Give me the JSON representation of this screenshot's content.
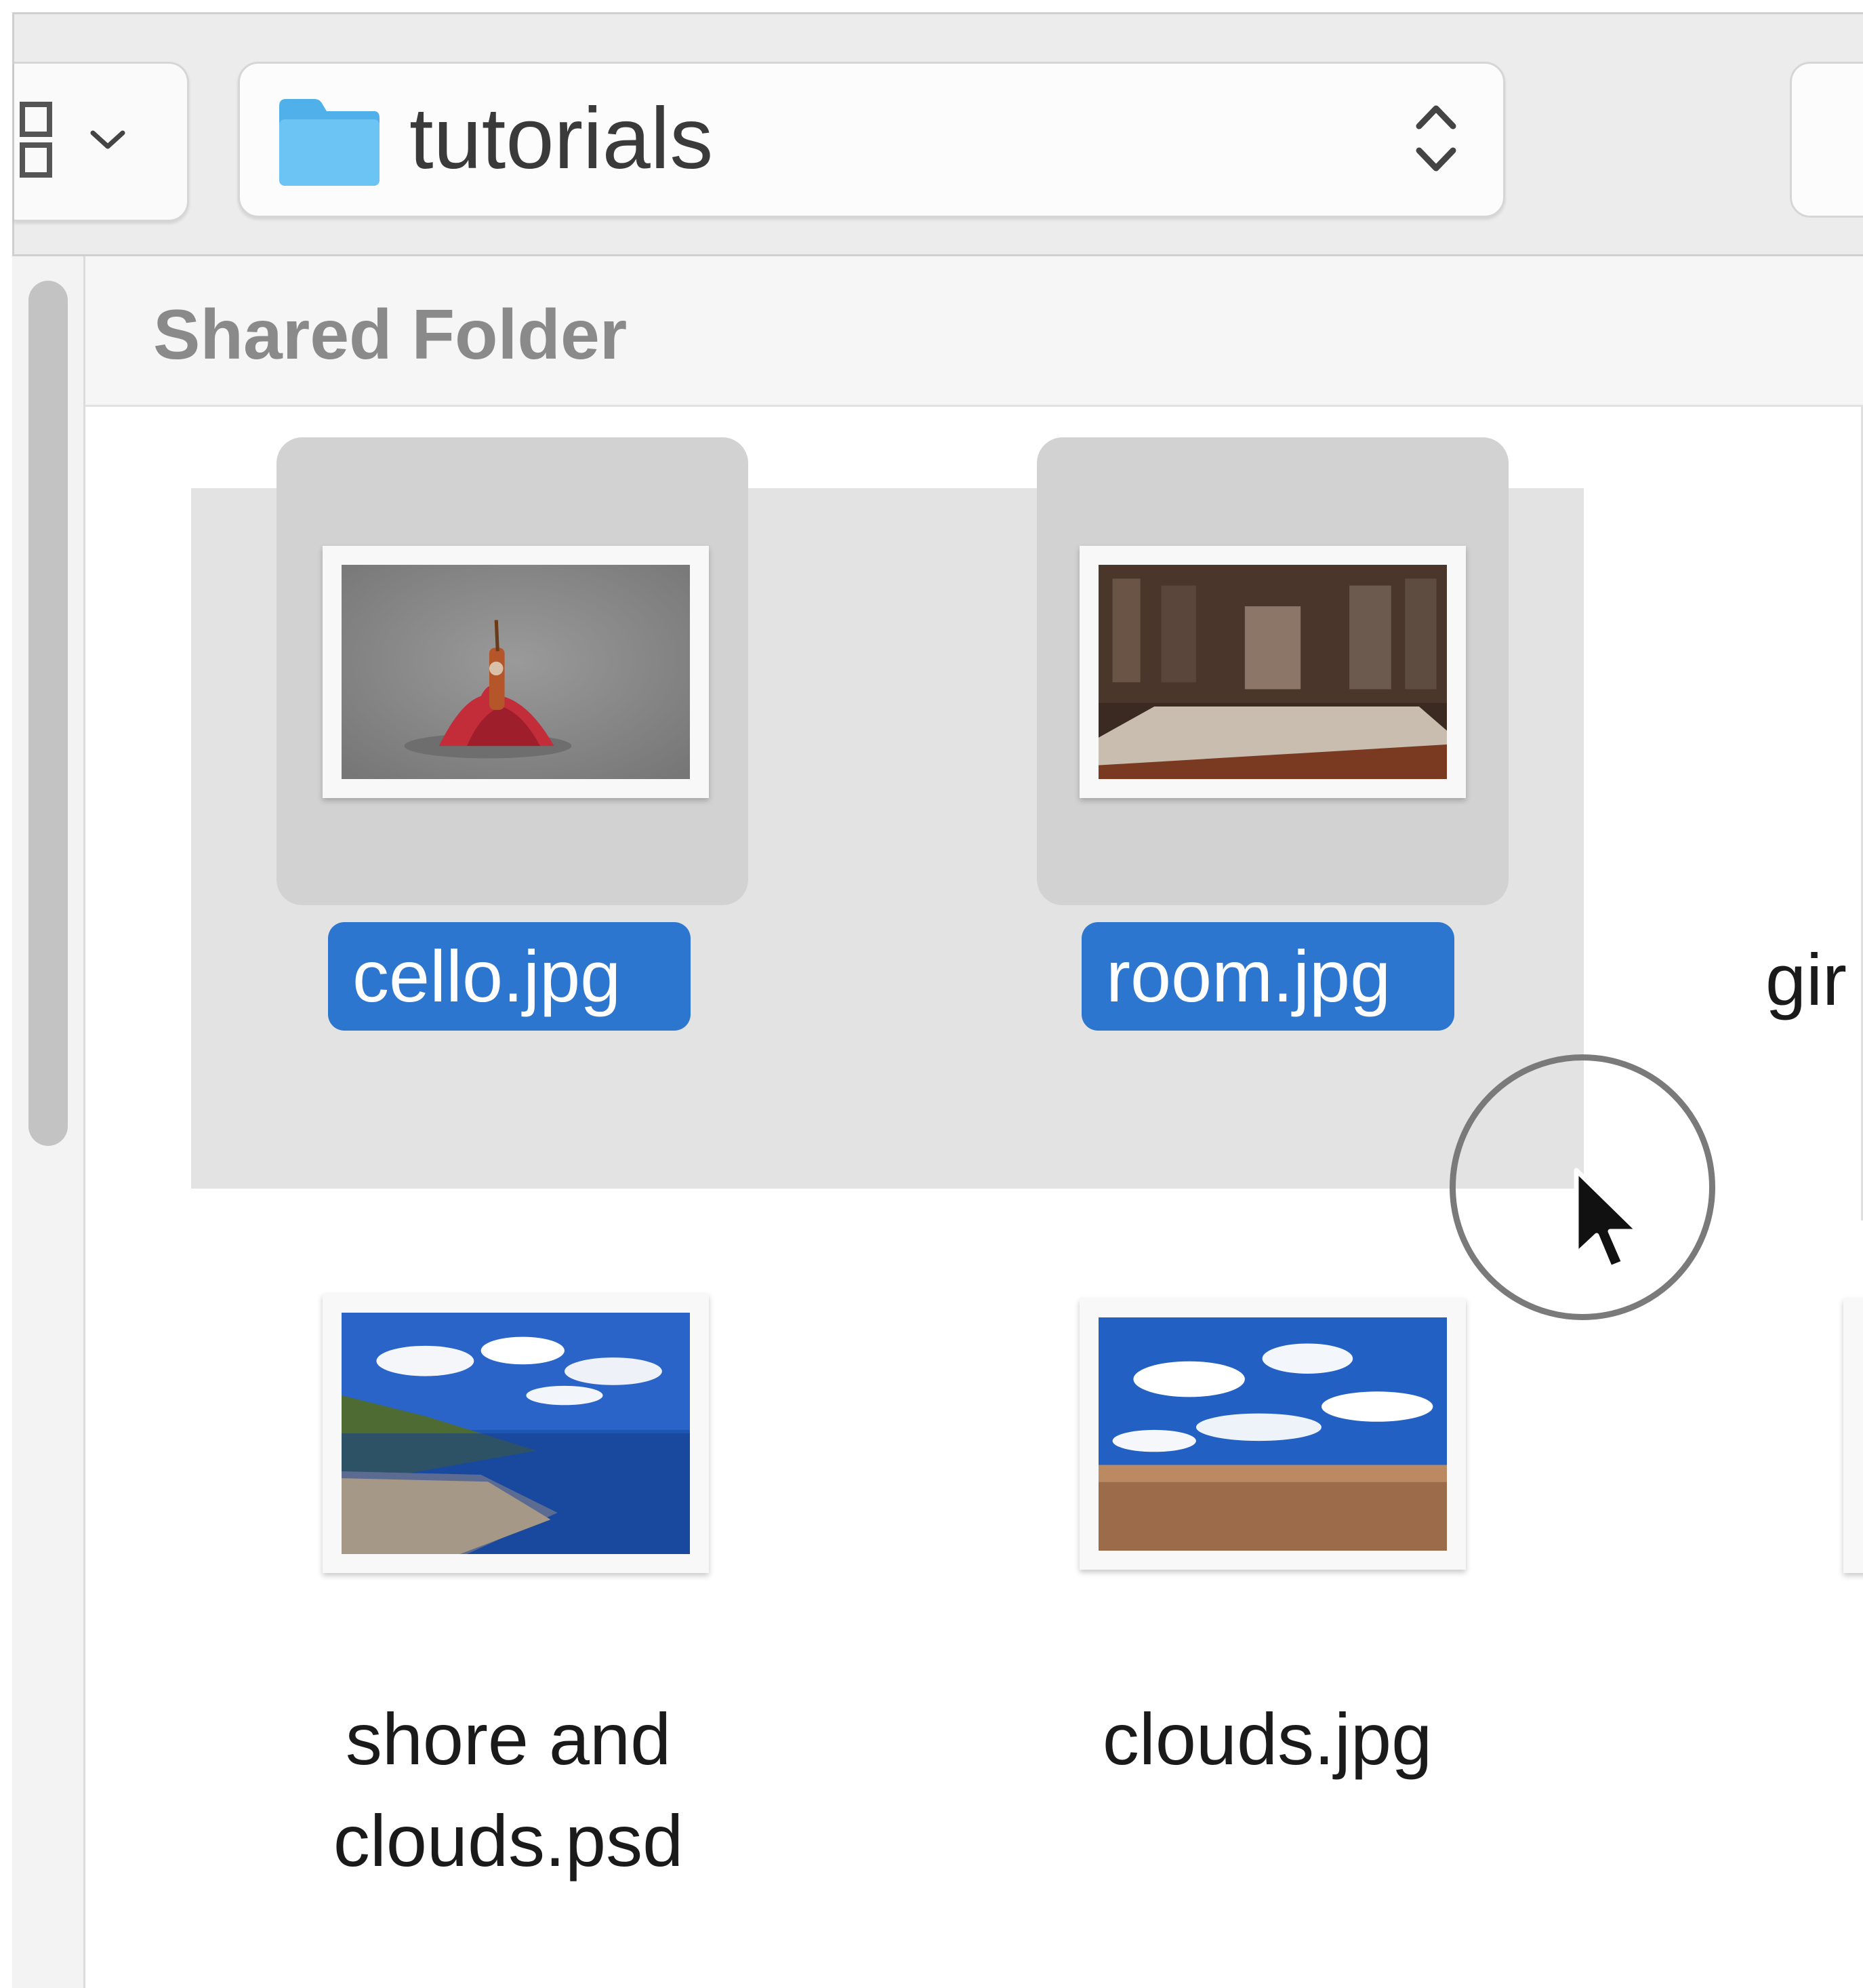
{
  "toolbar": {
    "view_menu": {
      "icon": "icon-grid-icon",
      "chevron": "chevron-down-icon"
    },
    "path_popup": {
      "folder_icon": "folder-icon",
      "label": "tutorials",
      "stepper_icon": "up-down-stepper-icon"
    }
  },
  "section": {
    "title": "Shared Folder"
  },
  "files": [
    {
      "name": "cello.jpg",
      "selected": true,
      "thumbnail": "cello"
    },
    {
      "name": "room.jpg",
      "selected": true,
      "thumbnail": "room"
    },
    {
      "name": "gir",
      "selected": false,
      "thumbnail": "partial"
    },
    {
      "name_line1": "shore and",
      "name_line2": "clouds.psd",
      "selected": false,
      "thumbnail": "shore"
    },
    {
      "name": "clouds.jpg",
      "selected": false,
      "thumbnail": "clouds"
    }
  ],
  "colors": {
    "selection_blue": "#2d76d0",
    "toolbar_bg": "#ececec",
    "marquee_gray": "#e3e3e3",
    "folder_blue": "#5ab8ef"
  },
  "cursor": {
    "type": "arrow",
    "highlight": "circle"
  }
}
